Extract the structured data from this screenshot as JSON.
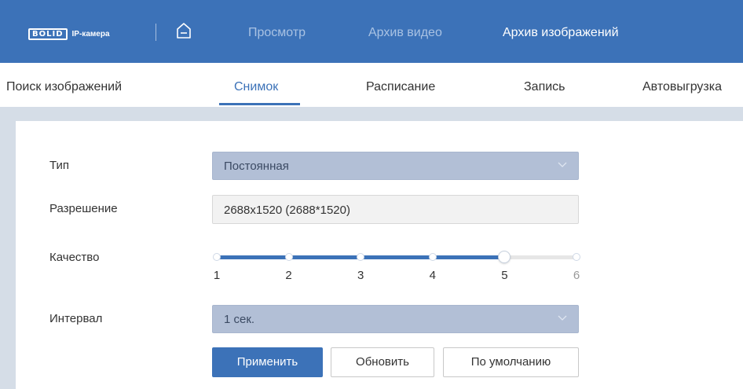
{
  "header": {
    "logo_text": "BOLID",
    "logo_sub": "IP-камера",
    "nav": [
      "Просмотр",
      "Архив видео",
      "Архив изображений"
    ],
    "active_nav_index": 2,
    "colors": {
      "header_bg": "#3c72b8",
      "nav_inactive": "#a9c2e3",
      "nav_active": "#ffffff"
    },
    "home_icon": "home-icon"
  },
  "subtabs": {
    "items": [
      "Поиск изображений",
      "Снимок",
      "Расписание",
      "Запись",
      "Автовыгрузка"
    ],
    "active_index": 1
  },
  "form": {
    "type": {
      "label": "Тип",
      "value": "Постоянная"
    },
    "resolution": {
      "label": "Разрешение",
      "value": "2688x1520 (2688*1520)"
    },
    "quality": {
      "label": "Качество",
      "ticks": [
        "1",
        "2",
        "3",
        "4",
        "5",
        "6"
      ],
      "value": 5,
      "max": 6
    },
    "interval": {
      "label": "Интервал",
      "value": "1 сек."
    }
  },
  "buttons": {
    "apply": "Применить",
    "refresh": "Обновить",
    "default": "По умолчанию"
  }
}
